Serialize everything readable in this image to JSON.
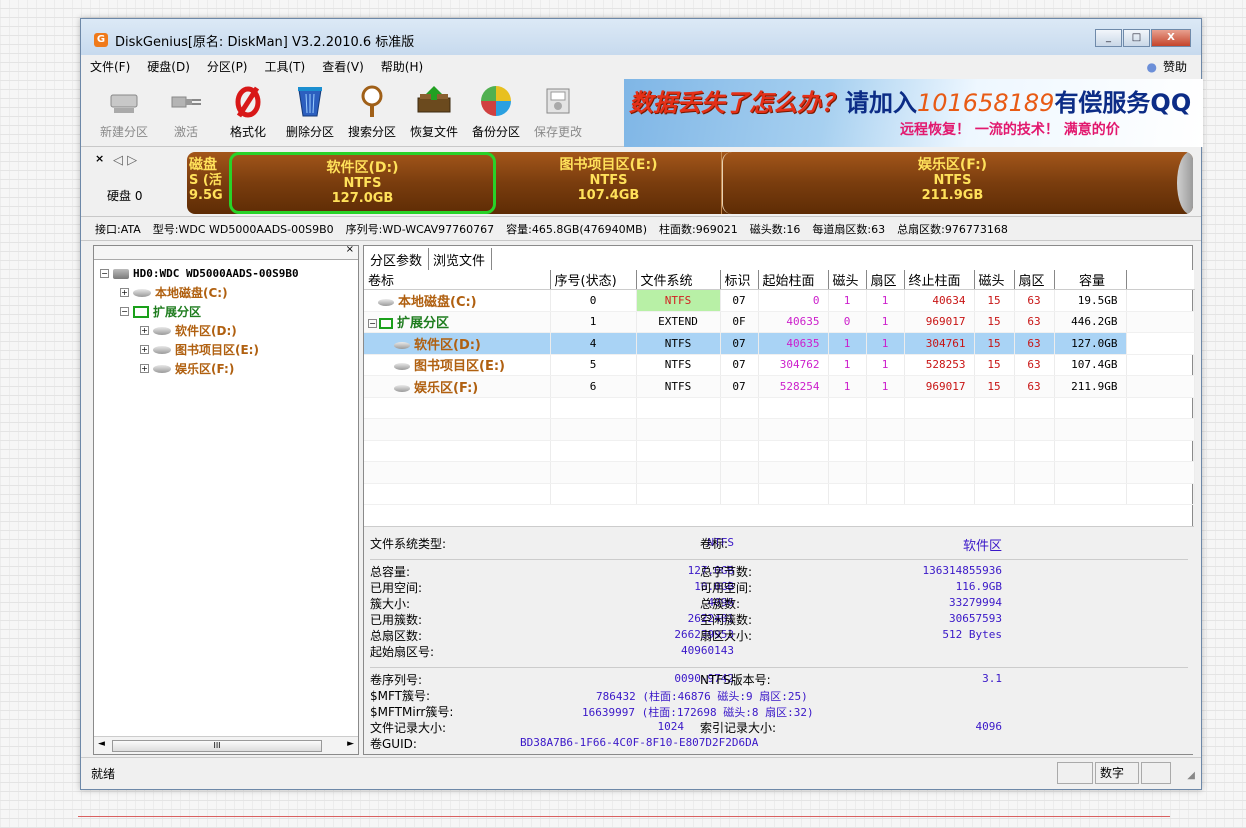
{
  "window": {
    "app_icon_glyph": "G",
    "title": "DiskGenius[原名: DiskMan] V3.2.2010.6 标准版",
    "buttons": [
      "_",
      "□",
      "X"
    ]
  },
  "menu": {
    "items": [
      "文件(F)",
      "硬盘(D)",
      "分区(P)",
      "工具(T)",
      "查看(V)",
      "帮助(H)"
    ],
    "right_dot": "●",
    "right_label": "赞助"
  },
  "toolbar": {
    "buttons": [
      {
        "label": "新建分区",
        "icon": "new-partition-icon",
        "enabled": false
      },
      {
        "label": "激活",
        "icon": "activate-icon",
        "enabled": false
      },
      {
        "label": "格式化",
        "icon": "format-icon",
        "enabled": true
      },
      {
        "label": "删除分区",
        "icon": "delete-partition-icon",
        "enabled": true
      },
      {
        "label": "搜索分区",
        "icon": "search-partition-icon",
        "enabled": true
      },
      {
        "label": "恢复文件",
        "icon": "recover-files-icon",
        "enabled": true
      },
      {
        "label": "备份分区",
        "icon": "backup-partition-icon",
        "enabled": true
      },
      {
        "label": "保存更改",
        "icon": "save-changes-icon",
        "enabled": false
      }
    ]
  },
  "banner": {
    "part1": "数据丢失了怎么办？",
    "part2": "请加入",
    "part3": "101658189",
    "part4": "有偿服务QQ",
    "sub": "远程恢复！ 一流的技术！ 满意的价"
  },
  "disk_map": {
    "close": "×",
    "nav": "◁ ▷",
    "disk_label": "硬盘 0",
    "partitions": [
      {
        "name": "磁盘",
        "fs": "S (活",
        "size": "9.5G"
      },
      {
        "name": "软件区(D:)",
        "fs": "NTFS",
        "size": "127.0GB"
      },
      {
        "name": "图书项目区(E:)",
        "fs": "NTFS",
        "size": "107.4GB"
      },
      {
        "name": "娱乐区(F:)",
        "fs": "NTFS",
        "size": "211.9GB"
      }
    ]
  },
  "disk_info": {
    "interface": "接口:ATA",
    "model": "型号:WDC WD5000AADS-00S9B0",
    "serial": "序列号:WD-WCAV97760767",
    "capacity": "容量:465.8GB(476940MB)",
    "cylinders": "柱面数:969021",
    "heads": "磁头数:16",
    "sectors_per_track": "每道扇区数:63",
    "total_sectors": "总扇区数:976773168"
  },
  "tree": {
    "close": "×",
    "disk": "HD0:WDC WD5000AADS-00S9B0",
    "local": "本地磁盘(C:)",
    "extended": "扩展分区",
    "software": "软件区(D:)",
    "books": "图书项目区(E:)",
    "entertainment": "娱乐区(F:)",
    "scroll_thumb": "III",
    "scroll_left": "◄",
    "scroll_right": "►"
  },
  "tabs": [
    "分区参数",
    "浏览文件"
  ],
  "partition_table": {
    "headers": [
      "卷标",
      "序号(状态)",
      "文件系统",
      "标识",
      "起始柱面",
      "磁头",
      "扇区",
      "终止柱面",
      "磁头",
      "扇区",
      "容量"
    ],
    "rows": [
      {
        "label": "本地磁盘(C:)",
        "num": "0",
        "fs": "NTFS",
        "id": "07",
        "start_cyl": "0",
        "start_head": "1",
        "start_sec": "1",
        "end_cyl": "40634",
        "end_head": "15",
        "end_sec": "63",
        "size": "19.5GB"
      },
      {
        "label": "扩展分区",
        "num": "1",
        "fs": "EXTEND",
        "id": "0F",
        "start_cyl": "40635",
        "start_head": "0",
        "start_sec": "1",
        "end_cyl": "969017",
        "end_head": "15",
        "end_sec": "63",
        "size": "446.2GB"
      },
      {
        "label": "软件区(D:)",
        "num": "4",
        "fs": "NTFS",
        "id": "07",
        "start_cyl": "40635",
        "start_head": "1",
        "start_sec": "1",
        "end_cyl": "304761",
        "end_head": "15",
        "end_sec": "63",
        "size": "127.0GB"
      },
      {
        "label": "图书项目区(E:)",
        "num": "5",
        "fs": "NTFS",
        "id": "07",
        "start_cyl": "304762",
        "start_head": "1",
        "start_sec": "1",
        "end_cyl": "528253",
        "end_head": "15",
        "end_sec": "63",
        "size": "107.4GB"
      },
      {
        "label": "娱乐区(F:)",
        "num": "6",
        "fs": "NTFS",
        "id": "07",
        "start_cyl": "528254",
        "start_head": "1",
        "start_sec": "1",
        "end_cyl": "969017",
        "end_head": "15",
        "end_sec": "63",
        "size": "211.9GB"
      }
    ],
    "selected_index": 2
  },
  "details": {
    "fs_type_label": "文件系统类型:",
    "fs_type_value": "NTFS",
    "vol_label": "卷标:",
    "vol_value": "软件区",
    "total_cap_label": "总容量:",
    "total_cap_value": "127.0GB",
    "used_label": "已用空间:",
    "used_value": "10.0GB",
    "cluster_size_label": "簇大小:",
    "cluster_size_value": "4096",
    "used_clusters_label": "已用簇数:",
    "used_clusters_value": "2622401",
    "total_sectors_label": "总扇区数:",
    "total_sectors_value": "266239953",
    "start_sector_label": "起始扇区号:",
    "start_sector_value": "40960143",
    "total_bytes_label": "总字节数:",
    "total_bytes_value": "136314855936",
    "free_label": "可用空间:",
    "free_value": "116.9GB",
    "total_clusters_label": "总簇数:",
    "total_clusters_value": "33279994",
    "free_clusters_label": "空闲簇数:",
    "free_clusters_value": "30657593",
    "sector_size_label": "扇区大小:",
    "sector_size_value": "512 Bytes",
    "serial_label": "卷序列号:",
    "serial_value": "0090-9742",
    "ntfs_ver_label": "NTFS版本号:",
    "ntfs_ver_value": "3.1",
    "mft_label": "$MFT簇号:",
    "mft_value": "786432 (柱面:46876 磁头:9 扇区:25)",
    "mftmirr_label": "$MFTMirr簇号:",
    "mftmirr_value": "16639997 (柱面:172698 磁头:8 扇区:32)",
    "record_size_label": "文件记录大小:",
    "record_size_value": "1024",
    "index_size_label": "索引记录大小:",
    "index_size_value": "4096",
    "guid_label": "卷GUID:",
    "guid_value": "BD38A7B6-1F66-4C0F-8F10-E807D2F2D6DA"
  },
  "status": {
    "text": "就绪",
    "indicator": "数字"
  }
}
